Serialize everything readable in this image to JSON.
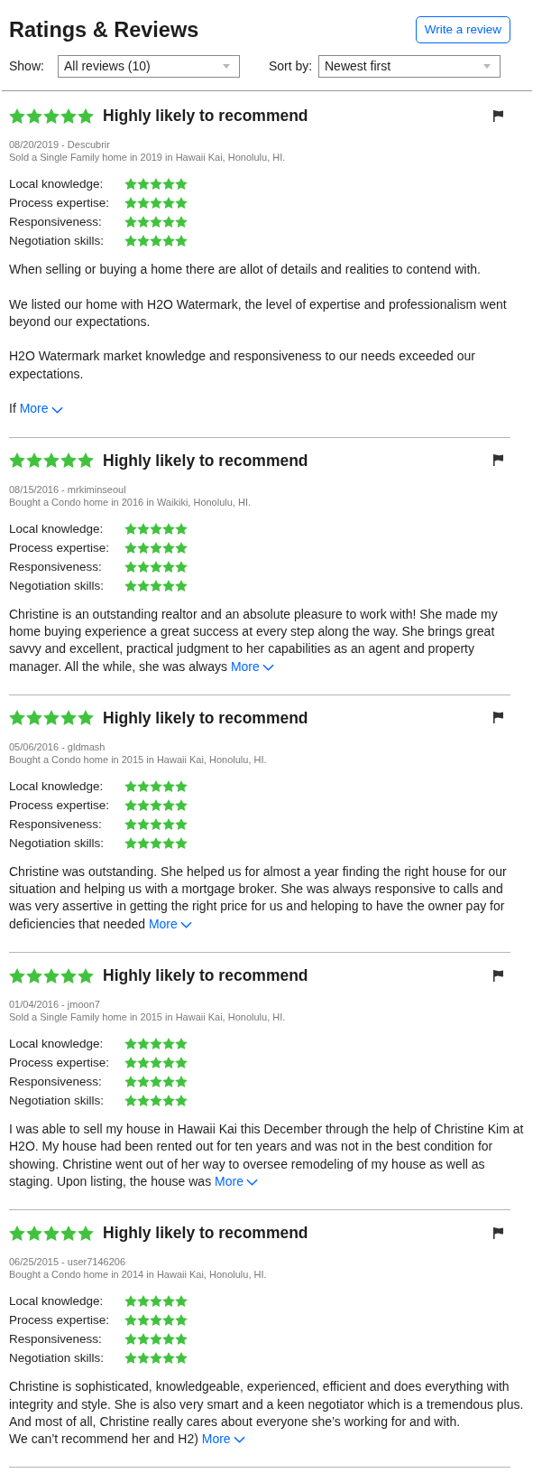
{
  "header": {
    "title": "Ratings & Reviews",
    "action": "Write a review"
  },
  "filters": [
    {
      "label": "Show:",
      "value": "All reviews (10)"
    },
    {
      "label": "Sort by:",
      "value": "Newest first"
    }
  ],
  "reviews": [
    {
      "stars": 5,
      "headline": "Highly likely to recommend",
      "byline": "08/20/2019 - Descubrir",
      "transaction": "Sold a Single Family home in 2019 in Hawaii Kai, Honolulu, HI.",
      "ratings": [
        {
          "label": "Local knowledge:",
          "stars": 5
        },
        {
          "label": "Process expertise:",
          "stars": 5
        },
        {
          "label": "Responsiveness:",
          "stars": 5
        },
        {
          "label": "Negotiation skills:",
          "stars": 5
        }
      ],
      "body": "When selling or buying a home there are allot of details and realities to contend with.\n\nWe listed our home with H2O Watermark, the level of expertise and professionalism went beyond our expectations.\n\nH2O Watermark market knowledge and responsiveness to our needs exceeded our expectations.\n\nIf",
      "more": "More"
    },
    {
      "stars": 5,
      "headline": "Highly likely to recommend",
      "byline": "08/15/2016 - mrkiminseoul",
      "transaction": "Bought a Condo home in 2016 in Waikiki, Honolulu, HI.",
      "ratings": [
        {
          "label": "Local knowledge:",
          "stars": 5
        },
        {
          "label": "Process expertise:",
          "stars": 5
        },
        {
          "label": "Responsiveness:",
          "stars": 5
        },
        {
          "label": "Negotiation skills:",
          "stars": 5
        }
      ],
      "body": "Christine is an outstanding realtor and an absolute pleasure to work with! She made my home buying experience a great success at every step along the way. She brings great savvy and excellent, practical judgment to her capabilities as an agent and property manager. All the while, she was always",
      "more": "More"
    },
    {
      "stars": 5,
      "headline": "Highly likely to recommend",
      "byline": "05/06/2016 - gldmash",
      "transaction": "Bought a Condo home in 2015 in Hawaii Kai, Honolulu, HI.",
      "ratings": [
        {
          "label": "Local knowledge:",
          "stars": 5
        },
        {
          "label": "Process expertise:",
          "stars": 5
        },
        {
          "label": "Responsiveness:",
          "stars": 5
        },
        {
          "label": "Negotiation skills:",
          "stars": 5
        }
      ],
      "body": "Christine was outstanding. She helped us for almost a year finding the right house for our situation and helping us with a mortgage broker. She was always responsive to calls and was very assertive in getting the right price for us and heloping to have the owner pay for deficiencies that needed",
      "more": "More"
    },
    {
      "stars": 5,
      "headline": "Highly likely to recommend",
      "byline": "01/04/2016 - jmoon7",
      "transaction": "Sold a Single Family home in 2015 in Hawaii Kai, Honolulu, HI.",
      "ratings": [
        {
          "label": "Local knowledge:",
          "stars": 5
        },
        {
          "label": "Process expertise:",
          "stars": 5
        },
        {
          "label": "Responsiveness:",
          "stars": 5
        },
        {
          "label": "Negotiation skills:",
          "stars": 5
        }
      ],
      "body": "I was able to sell my house in Hawaii Kai this December through the help of Christine Kim at H2O. My house had been rented out for ten years and was not in the best condition for showing. Christine went out of her way to oversee remodeling of my house as well as staging. Upon listing, the house was",
      "more": "More"
    },
    {
      "stars": 5,
      "headline": "Highly likely to recommend",
      "byline": "06/25/2015 - user7146206",
      "transaction": "Bought a Condo home in 2014 in Hawaii Kai, Honolulu, HI.",
      "ratings": [
        {
          "label": "Local knowledge:",
          "stars": 5
        },
        {
          "label": "Process expertise:",
          "stars": 5
        },
        {
          "label": "Responsiveness:",
          "stars": 5
        },
        {
          "label": "Negotiation skills:",
          "stars": 5
        }
      ],
      "body": "Christine is sophisticated, knowledgeable, experienced, efficient and does everything with integrity and style. She is also very smart and a keen negotiator which is a tremendous plus. And most of all, Christine really cares about everyone she’s working for and with.\nWe can’t recommend her and H2)",
      "more": "More"
    }
  ]
}
